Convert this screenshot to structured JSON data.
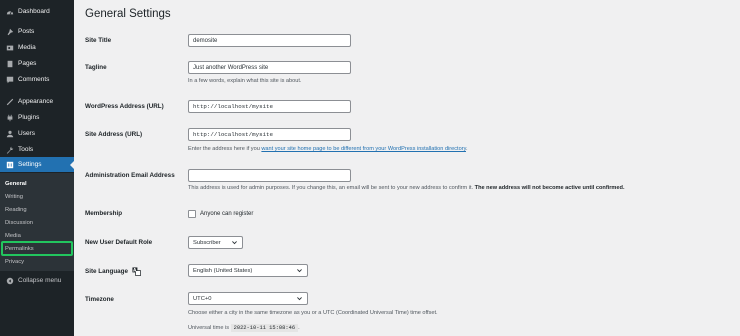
{
  "sidebar": {
    "items": [
      {
        "label": "Dashboard",
        "icon": "dashboard-icon"
      },
      {
        "label": "Posts",
        "icon": "pin-icon"
      },
      {
        "label": "Media",
        "icon": "media-icon"
      },
      {
        "label": "Pages",
        "icon": "page-icon"
      },
      {
        "label": "Comments",
        "icon": "comment-icon"
      },
      {
        "label": "Appearance",
        "icon": "brush-icon"
      },
      {
        "label": "Plugins",
        "icon": "plugin-icon"
      },
      {
        "label": "Users",
        "icon": "user-icon"
      },
      {
        "label": "Tools",
        "icon": "wrench-icon"
      },
      {
        "label": "Settings",
        "icon": "settings-icon"
      }
    ],
    "submenu": [
      "General",
      "Writing",
      "Reading",
      "Discussion",
      "Media",
      "Permalinks",
      "Privacy"
    ],
    "collapse_label": "Collapse menu"
  },
  "page": {
    "title": "General Settings",
    "site_title": {
      "label": "Site Title",
      "value": "demosite"
    },
    "tagline": {
      "label": "Tagline",
      "value": "Just another WordPress site",
      "desc": "In a few words, explain what this site is about."
    },
    "wp_address": {
      "label": "WordPress Address (URL)",
      "value": "http://localhost/mysite"
    },
    "site_address": {
      "label": "Site Address (URL)",
      "value": "http://localhost/mysite",
      "desc_before": "Enter the address here if you ",
      "desc_link": "want your site home page to be different from your WordPress installation directory",
      "desc_after": "."
    },
    "admin_email": {
      "label": "Administration Email Address",
      "value": "",
      "desc": "This address is used for admin purposes. If you change this, an email will be sent to your new address to confirm it. ",
      "desc_bold": "The new address will not become active until confirmed."
    },
    "membership": {
      "label": "Membership",
      "checkbox_label": "Anyone can register"
    },
    "default_role": {
      "label": "New User Default Role",
      "value": "Subscriber"
    },
    "site_language": {
      "label": "Site Language",
      "value": "English (United States)"
    },
    "timezone": {
      "label": "Timezone",
      "value": "UTC+0",
      "desc": "Choose either a city in the same timezone as you or a UTC (Coordinated Universal Time) time offset."
    },
    "universal_time": {
      "label": "Universal time is",
      "value": "2022-10-11 15:08:46",
      "suffix": "."
    }
  }
}
